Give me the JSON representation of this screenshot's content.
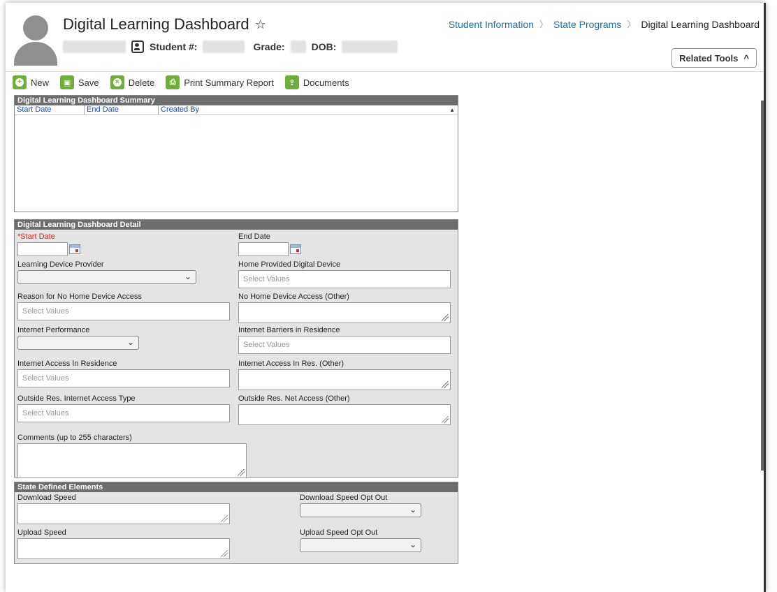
{
  "header": {
    "title": "Digital Learning Dashboard",
    "student_label": "Student #:",
    "grade_label": "Grade:",
    "dob_label": "DOB:"
  },
  "breadcrumb": {
    "items": [
      "Student Information",
      "State Programs",
      "Digital Learning Dashboard"
    ]
  },
  "related_tools": "Related Tools",
  "toolbar": {
    "new": "New",
    "save": "Save",
    "delete": "Delete",
    "print": "Print Summary Report",
    "documents": "Documents"
  },
  "summary": {
    "title": "Digital Learning Dashboard Summary",
    "columns": [
      "Start Date",
      "End Date",
      "Created By"
    ]
  },
  "detail": {
    "title": "Digital Learning Dashboard Detail",
    "start_date": "*Start Date",
    "end_date": "End Date",
    "learning_device_provider": "Learning Device Provider",
    "home_provided_device": "Home Provided Digital Device",
    "reason_no_home_access": "Reason for No Home Device Access",
    "no_home_access_other": "No Home Device Access (Other)",
    "internet_performance": "Internet Performance",
    "internet_barriers": "Internet Barriers in Residence",
    "internet_access_residence": "Internet Access In Residence",
    "internet_access_other": "Internet Access In Res. (Other)",
    "outside_access_type": "Outside Res. Internet Access Type",
    "outside_access_other": "Outside Res. Net Access (Other)",
    "comments": "Comments (up to 255 characters)",
    "placeholder": "Select Values"
  },
  "state": {
    "title": "State Defined Elements",
    "download_speed": "Download Speed",
    "download_opt_out": "Download Speed Opt Out",
    "upload_speed": "Upload Speed",
    "upload_opt_out": "Upload Speed Opt Out"
  },
  "colors": {
    "accent_green": "#6fae3a",
    "link_blue": "#1a6fb5",
    "panel_header": "#6d6d6d",
    "required_red": "#e02020"
  }
}
